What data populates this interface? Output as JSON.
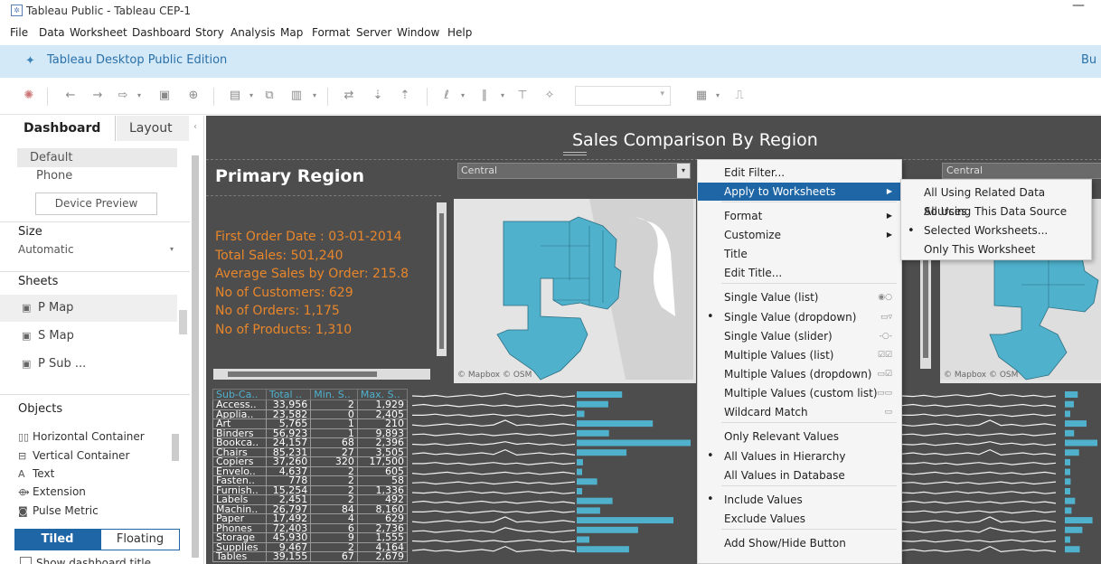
{
  "window": {
    "title": "Tableau Public - Tableau  CEP-1",
    "minimize": "—"
  },
  "menubar": [
    "File",
    "Data",
    "Worksheet",
    "Dashboard",
    "Story",
    "Analysis",
    "Map",
    "Format",
    "Server",
    "Window",
    "Help"
  ],
  "banner": {
    "label": "Tableau Desktop Public Edition",
    "right_label": "Bu"
  },
  "left_pane": {
    "tabs": [
      "Dashboard",
      "Layout"
    ],
    "devices": [
      "Default",
      "Phone"
    ],
    "device_preview": "Device Preview",
    "size_header": "Size",
    "size_value": "Automatic",
    "sheets_header": "Sheets",
    "sheets": [
      "P Map",
      "S Map",
      "P Sub ..."
    ],
    "objects_header": "Objects",
    "objects": [
      "Horizontal Container",
      "Vertical Container",
      "Text",
      "Extension",
      "Pulse Metric"
    ],
    "tiled": "Tiled",
    "floating": "Floating",
    "show_title": "Show dashboard title"
  },
  "dashboard": {
    "title": "Sales Comparison By Region",
    "primary_heading": "Primary Region",
    "primary_filter": "Central",
    "second_filter": "Central",
    "kpis": [
      "First Order Date : 03-01-2014",
      "Total Sales: 501,240",
      "Average Sales by Order: 215.8",
      "No of Customers: 629",
      "No of Orders: 1,175",
      "No of Products: 1,310"
    ],
    "map_credit": "© Mapbox © OSM",
    "crosstab": {
      "headers": [
        "Sub-Ca..",
        "Total ..",
        "Min. S..",
        "Max. S.."
      ],
      "rows": [
        [
          "Access..",
          "33,956",
          "2",
          "1,929"
        ],
        [
          "Applia..",
          "23,582",
          "0",
          "2,405"
        ],
        [
          "Art",
          "5,765",
          "1",
          "210"
        ],
        [
          "Binders",
          "56,923",
          "1",
          "9,893"
        ],
        [
          "Bookca..",
          "24,157",
          "68",
          "2,396"
        ],
        [
          "Chairs",
          "85,231",
          "27",
          "3,505"
        ],
        [
          "Copiers",
          "37,260",
          "320",
          "17,500"
        ],
        [
          "Envelo..",
          "4,637",
          "2",
          "605"
        ],
        [
          "Fasten..",
          "778",
          "2",
          "58"
        ],
        [
          "Furnish..",
          "15,254",
          "2",
          "1,336"
        ],
        [
          "Labels",
          "2,451",
          "2",
          "492"
        ],
        [
          "Machin..",
          "26,797",
          "84",
          "8,160"
        ],
        [
          "Paper",
          "17,492",
          "4",
          "629"
        ],
        [
          "Phones",
          "72,403",
          "6",
          "2,736"
        ],
        [
          "Storage",
          "45,930",
          "9",
          "1,555"
        ],
        [
          "Supplies",
          "9,467",
          "2",
          "4,164"
        ],
        [
          "Tables",
          "39,155",
          "67",
          "2,679"
        ]
      ]
    }
  },
  "context_menu": {
    "items": [
      {
        "label": "Edit Filter..."
      },
      {
        "label": "Apply to Worksheets",
        "submenu": true,
        "highlighted": true
      },
      {
        "label": "Format",
        "submenu": true
      },
      {
        "label": "Customize",
        "submenu": true
      },
      {
        "label": "Title"
      },
      {
        "label": "Edit Title..."
      },
      {
        "label": "Single Value (list)",
        "icon": "radio-icon"
      },
      {
        "label": "Single Value (dropdown)",
        "icon": "dropdown-icon",
        "checked": true
      },
      {
        "label": "Single Value (slider)",
        "icon": "slider-icon"
      },
      {
        "label": "Multiple Values (list)",
        "icon": "checkbox-list-icon"
      },
      {
        "label": "Multiple Values (dropdown)",
        "icon": "multi-dropdown-icon"
      },
      {
        "label": "Multiple Values (custom list)",
        "icon": "custom-list-icon"
      },
      {
        "label": "Wildcard Match",
        "icon": "wildcard-icon"
      },
      {
        "label": "Only Relevant Values"
      },
      {
        "label": "All Values in Hierarchy",
        "checked": true
      },
      {
        "label": "All Values in Database"
      },
      {
        "label": "Include Values",
        "checked": true
      },
      {
        "label": "Exclude Values"
      },
      {
        "label": "Add Show/Hide Button"
      }
    ]
  },
  "submenu": {
    "items": [
      {
        "label": "All Using Related Data Sources"
      },
      {
        "label": "All Using This Data Source"
      },
      {
        "label": "Selected Worksheets...",
        "checked": true
      },
      {
        "label": "Only This Worksheet"
      }
    ]
  },
  "colors": {
    "accent": "#1f66a6",
    "kpi": "#e8862b",
    "map_region": "#4fb1cc",
    "canvas": "#4d4d4d",
    "banner": "#d4e9f7"
  }
}
